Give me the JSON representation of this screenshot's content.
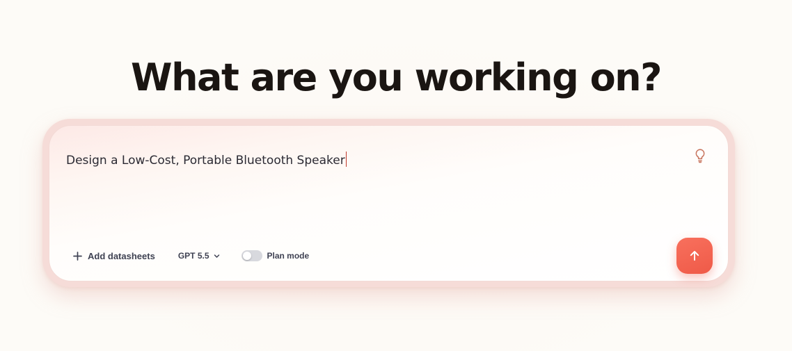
{
  "headline": "What are you working on?",
  "composer": {
    "prompt_value": "Design a Low-Cost, Portable Bluetooth Speaker",
    "idea_icon": "lightbulb-icon",
    "toolbar": {
      "add_label": "Add datasheets",
      "add_icon": "plus-icon",
      "model_label": "GPT 5.5",
      "model_icon": "chevron-down-icon",
      "plan_label": "Plan mode",
      "plan_enabled": false
    },
    "send_icon": "arrow-up-icon"
  },
  "colors": {
    "background": "#fdfbf7",
    "headline": "#1a1512",
    "accent": "#ef5a48",
    "halo": "#f6dcd8",
    "toolbar_text": "#3f4253",
    "idea_icon": "#c8755f"
  }
}
